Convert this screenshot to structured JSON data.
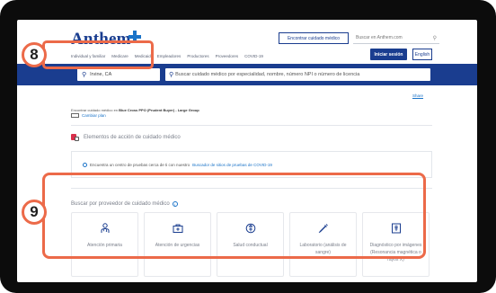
{
  "header": {
    "logo_text": "Anthem",
    "find_care_label": "Encontrar cuidado médico",
    "site_search_placeholder": "Buscar en Anthem.com",
    "nav_items": [
      "Individual y familiar",
      "Medicare",
      "Medicaid",
      "Empleadores",
      "Productores",
      "Proveedores",
      "COVID-19"
    ],
    "login_label": "Iniciar sesión",
    "language_label": "English",
    "brand_color": "#1a3d8f"
  },
  "search": {
    "location_value": "Irvine, CA",
    "query_placeholder": "Buscar cuidado médico por especialidad, nombre, número NPI o número de licencia"
  },
  "callouts": {
    "location_badge": "8",
    "providers_badge": "9",
    "color": "#ec6a49"
  },
  "share_label": "Share",
  "plan": {
    "prefix": "Encontrar cuidado médico en",
    "plan_name": "Blue Cross PPO (Prudent Buyer) - Large Group",
    "change_label": "Cambiar plan"
  },
  "action_section": {
    "title": "Elementos de acción de cuidado médico",
    "notice_text": "Encuentra un centro de pruebas cerca de ti con nuestro",
    "notice_link": "Buscador de sitios de pruebas de COVID-19"
  },
  "providers": {
    "title": "Buscar por proveedor de cuidado médico",
    "cards": [
      {
        "label": "Atención primaria",
        "icon": "doctor-icon"
      },
      {
        "label": "Atención de urgencias",
        "icon": "first-aid-kit-icon"
      },
      {
        "label": "Salud conductual",
        "icon": "behavioral-health-icon"
      },
      {
        "label": "Laboratorio (análisis de sangre)",
        "icon": "syringe-icon"
      },
      {
        "label": "Diagnóstico por imágenes (Resonancia magnética o rayos X)",
        "icon": "imaging-icon"
      }
    ]
  }
}
